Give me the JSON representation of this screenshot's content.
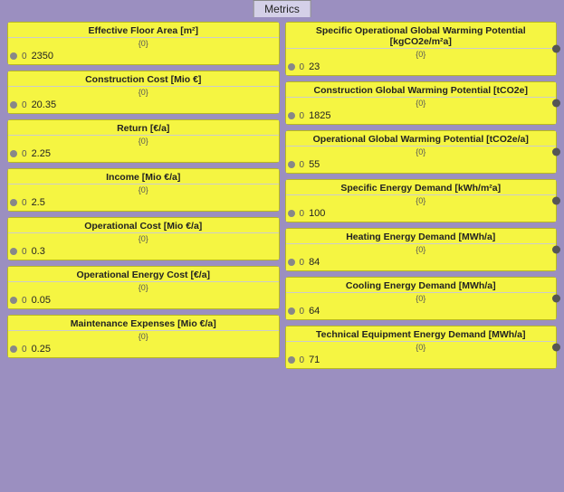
{
  "tab": {
    "label": "Metrics"
  },
  "nodes": {
    "left": [
      {
        "id": "effective-floor-area",
        "title": "Effective Floor Area [m²]",
        "sub": "{0}",
        "index": "0",
        "value": "2350"
      },
      {
        "id": "construction-cost",
        "title": "Construction Cost [Mio €]",
        "sub": "{0}",
        "index": "0",
        "value": "20.35"
      },
      {
        "id": "return",
        "title": "Return [€/a]",
        "sub": "{0}",
        "index": "0",
        "value": "2.25"
      },
      {
        "id": "income",
        "title": "Income [Mio €/a]",
        "sub": "{0}",
        "index": "0",
        "value": "2.5"
      },
      {
        "id": "operational-cost",
        "title": "Operational Cost [Mio €/a]",
        "sub": "{0}",
        "index": "0",
        "value": "0.3"
      },
      {
        "id": "operational-energy-cost",
        "title": "Operational Energy Cost [€/a]",
        "sub": "{0}",
        "index": "0",
        "value": "0.05"
      },
      {
        "id": "maintenance-expenses",
        "title": "Maintenance Expenses [Mio €/a]",
        "sub": "{0}",
        "index": "0",
        "value": "0.25"
      }
    ],
    "right": [
      {
        "id": "specific-operational-gwp",
        "title": "Specific Operational Global Warming Potential [kgCO2e/m²a]",
        "sub": "{0}",
        "index": "0",
        "value": "23"
      },
      {
        "id": "construction-gwp",
        "title": "Construction Global Warming Potential [tCO2e]",
        "sub": "{0}",
        "index": "0",
        "value": "1825"
      },
      {
        "id": "operational-gwp",
        "title": "Operational Global Warming Potential [tCO2e/a]",
        "sub": "{0}",
        "index": "0",
        "value": "55"
      },
      {
        "id": "specific-energy-demand",
        "title": "Specific Energy Demand [kWh/m²a]",
        "sub": "{0}",
        "index": "0",
        "value": "100"
      },
      {
        "id": "heating-energy-demand",
        "title": "Heating Energy Demand [MWh/a]",
        "sub": "{0}",
        "index": "0",
        "value": "84"
      },
      {
        "id": "cooling-energy-demand",
        "title": "Cooling Energy Demand [MWh/a]",
        "sub": "{0}",
        "index": "0",
        "value": "64"
      },
      {
        "id": "technical-equipment-energy",
        "title": "Technical Equipment Energy Demand [MWh/a]",
        "sub": "{0}",
        "index": "0",
        "value": "71"
      }
    ]
  }
}
